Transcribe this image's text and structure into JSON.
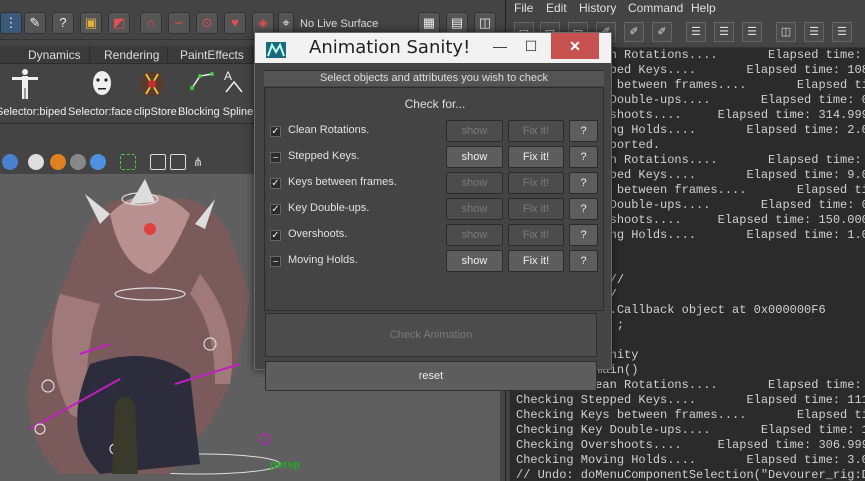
{
  "maya": {
    "status_line": {
      "live_surface_label": "No Live Surface"
    },
    "shelf_tabs": [
      "Dynamics",
      "Rendering",
      "PaintEffects"
    ],
    "shelf_items": [
      {
        "label": "Selector:biped",
        "icon": "biped-icon"
      },
      {
        "label": "Selector:face",
        "icon": "face-icon"
      },
      {
        "label": "clipStore",
        "icon": "clipstore-icon"
      },
      {
        "label": "Blocking Spline",
        "icon": "blocking-spline-icon"
      }
    ],
    "viewport": {
      "camera_label": "persp"
    }
  },
  "script_editor": {
    "menu": [
      "File",
      "Edit",
      "History",
      "Command",
      "Help"
    ],
    "output_lines": [
      "Checking Clean Rotations....       Elapsed time:",
      "Checking Stepped Keys....       Elapsed time: 108.",
      "Checking Keys between frames....       Elapsed ti",
      "Checking Key Double-ups....       Elapsed time: 0.99",
      "Checking Overshoots....     Elapsed time: 314.9998",
      "Checking Moving Holds....       Elapsed time: 2.00",
      "// Result: imported.",
      "Checking Clean Rotations....       Elapsed time:",
      "Checking Stepped Keys....       Elapsed time: 9.00",
      "Checking Keys between frames....       Elapsed ti",
      "Checking Key Double-ups....       Elapsed time: 0.0m",
      "Checking Overshoots....     Elapsed time: 150.0000",
      "Checking Moving Holds....       Elapsed time: 1.00",
      "select ;",
      "",
      "select -cl   //",
      "currentTime //",
      "// animsanity.Callback object at 0x000000F6",
      "select -clear ;",
      "",
      "import animsanity",
      "animsanity.main()",
      "Checking Clean Rotations....       Elapsed time:",
      "Checking Stepped Keys....       Elapsed time: 111.",
      "Checking Keys between frames....       Elapsed ti",
      "Checking Key Double-ups....       Elapsed time: 1.00",
      "Checking Overshoots....     Elapsed time: 306.9999",
      "Checking Moving Holds....       Elapsed time: 3.00",
      "// Undo: doMenuComponentSelection(\"Devourer_rig:De"
    ]
  },
  "dialog": {
    "title": "Animation Sanity!",
    "subtitle": "Select objects and attributes you wish to check",
    "check_for_label": "Check for...",
    "rows": [
      {
        "label": "Clean Rotations.",
        "checked": true,
        "show": "show",
        "fix": "Fix it!",
        "help": "?",
        "enabled": false
      },
      {
        "label": "Stepped Keys.",
        "checked": false,
        "show": "show",
        "fix": "Fix it!",
        "help": "?",
        "enabled": true
      },
      {
        "label": "Keys between frames.",
        "checked": true,
        "show": "show",
        "fix": "Fix it!",
        "help": "?",
        "enabled": false
      },
      {
        "label": "Key Double-ups.",
        "checked": true,
        "show": "show",
        "fix": "Fix it!",
        "help": "?",
        "enabled": false
      },
      {
        "label": "Overshoots.",
        "checked": true,
        "show": "show",
        "fix": "Fix it!",
        "help": "?",
        "enabled": false
      },
      {
        "label": "Moving Holds.",
        "checked": false,
        "show": "show",
        "fix": "Fix it!",
        "help": "?",
        "enabled": true
      }
    ],
    "check_button": "Check Animation",
    "reset_button": "reset"
  }
}
